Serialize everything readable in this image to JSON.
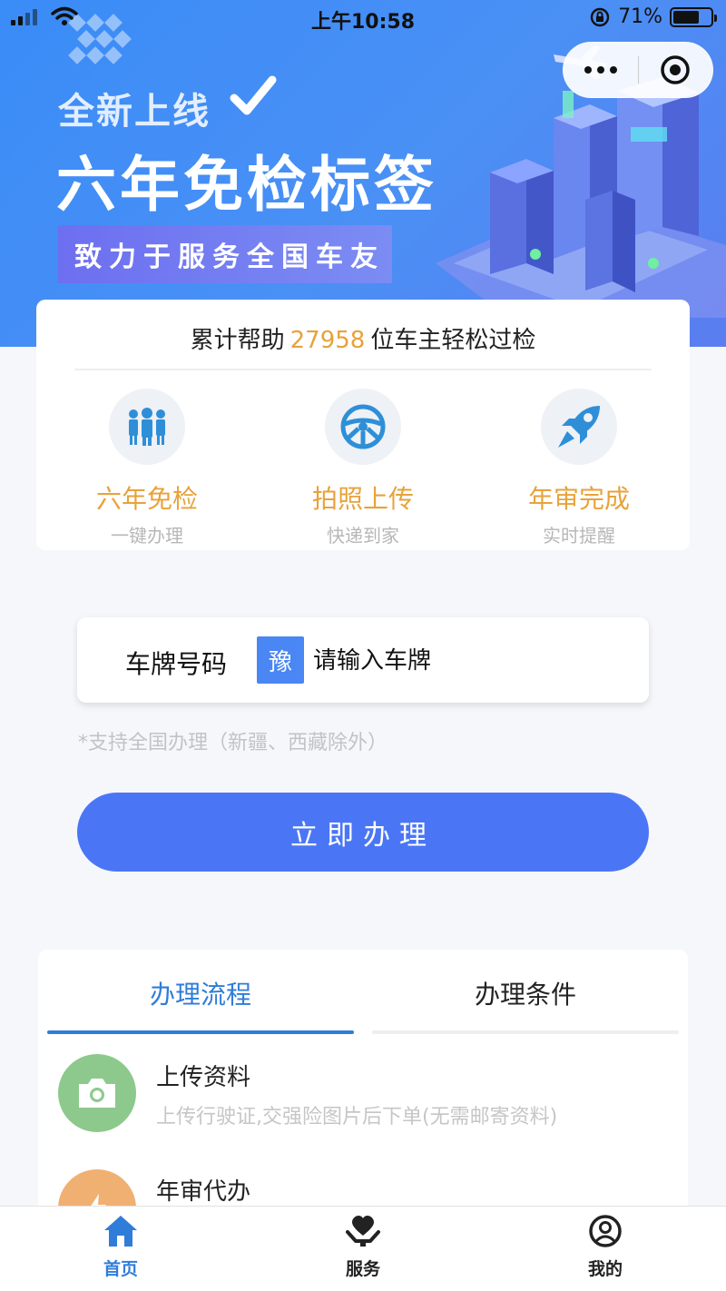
{
  "status_bar": {
    "time": "上午10:58",
    "battery": "71%",
    "battery_level": 0.71
  },
  "capsule": {
    "more_icon": "more-dots-icon",
    "close_icon": "target-icon"
  },
  "hero": {
    "subtitle": "全新上线",
    "title": "六年免检标签",
    "tagline": "致力于服务全国车友"
  },
  "stats": {
    "prefix": "累计帮助",
    "count": "27958",
    "suffix": "位车主轻松过检"
  },
  "features": [
    {
      "icon": "people-group-icon",
      "title": "六年免检",
      "subtitle": "一键办理"
    },
    {
      "icon": "steering-wheel-icon",
      "title": "拍照上传",
      "subtitle": "快递到家"
    },
    {
      "icon": "rocket-icon",
      "title": "年审完成",
      "subtitle": "实时提醒"
    }
  ],
  "plate": {
    "label": "车牌号码",
    "province": "豫",
    "placeholder": "请输入车牌"
  },
  "support_note": "*支持全国办理（新疆、西藏除外）",
  "submit_label": "立即办理",
  "process": {
    "tabs": [
      "办理流程",
      "办理条件"
    ],
    "active_tab": 0,
    "steps": [
      {
        "icon": "camera-icon",
        "color": "#8dc98c",
        "title": "上传资料",
        "desc": "上传行驶证,交强险图片后下单(无需邮寄资料)"
      },
      {
        "icon": "lightning-icon",
        "color": "#f0b072",
        "title": "年审代办",
        "desc": ""
      }
    ]
  },
  "tabbar": [
    {
      "icon": "home-icon",
      "label": "首页",
      "color": "#2f7cd9"
    },
    {
      "icon": "service-heart-icon",
      "label": "服务",
      "color": "#222222"
    },
    {
      "icon": "user-icon",
      "label": "我的",
      "color": "#222222"
    }
  ]
}
